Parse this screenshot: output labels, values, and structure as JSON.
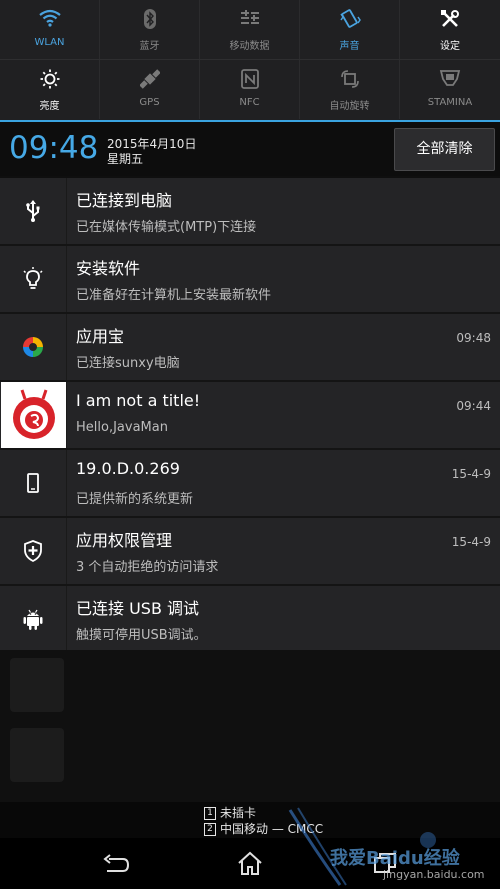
{
  "quick_settings": {
    "row1": [
      {
        "label": "WLAN",
        "icon": "wifi-icon",
        "state": "active"
      },
      {
        "label": "蓝牙",
        "icon": "bluetooth-icon",
        "state": "off"
      },
      {
        "label": "移动数据",
        "icon": "mobile-data-icon",
        "state": "off"
      },
      {
        "label": "声音",
        "icon": "vibrate-icon",
        "state": "active"
      },
      {
        "label": "设定",
        "icon": "tools-icon",
        "state": "white"
      }
    ],
    "row2": [
      {
        "label": "亮度",
        "icon": "brightness-icon",
        "state": "white"
      },
      {
        "label": "GPS",
        "icon": "gps-icon",
        "state": "off"
      },
      {
        "label": "NFC",
        "icon": "nfc-icon",
        "state": "off"
      },
      {
        "label": "自动旋转",
        "icon": "rotate-icon",
        "state": "off"
      },
      {
        "label": "STAMINA",
        "icon": "stamina-icon",
        "state": "off"
      }
    ]
  },
  "header": {
    "time": "09:48",
    "date": "2015年4月10日",
    "weekday": "星期五",
    "clear_all": "全部清除"
  },
  "notifications": [
    {
      "icon": "usb-icon",
      "title": "已连接到电脑",
      "subtitle": "已在媒体传输模式(MTP)下连接",
      "time": ""
    },
    {
      "icon": "lightbulb-icon",
      "title": "安装软件",
      "subtitle": "已准备好在计算机上安装最新软件",
      "time": ""
    },
    {
      "icon": "yingyongbao-app-icon",
      "title": "应用宝",
      "subtitle": "已连接sunxy电脑",
      "time": "09:48"
    },
    {
      "icon": "app-avatar-icon",
      "title": "I am not a title!",
      "subtitle": "Hello,JavaMan",
      "time": "09:44"
    },
    {
      "icon": "phone-icon",
      "title": "19.0.D.0.269",
      "subtitle": "已提供新的系统更新",
      "time": "15-4-9"
    },
    {
      "icon": "shield-plus-icon",
      "title": "应用权限管理",
      "subtitle": "3 个自动拒绝的访问请求",
      "time": "15-4-9"
    },
    {
      "icon": "android-icon",
      "title": "已连接 USB 调试",
      "subtitle": "触摸可停用USB调试。",
      "time": ""
    }
  ],
  "sim_status": {
    "sim1_num": "1",
    "sim1": "未插卡",
    "sim2_num": "2",
    "sim2": "中国移动 — CMCC"
  },
  "watermark": {
    "text": "我爱Baidu经验",
    "url": "jingyan.baidu.com"
  },
  "colors": {
    "accent": "#3aa3e0",
    "active_tile": "#4aa3df",
    "notification_bg": "#242426"
  }
}
